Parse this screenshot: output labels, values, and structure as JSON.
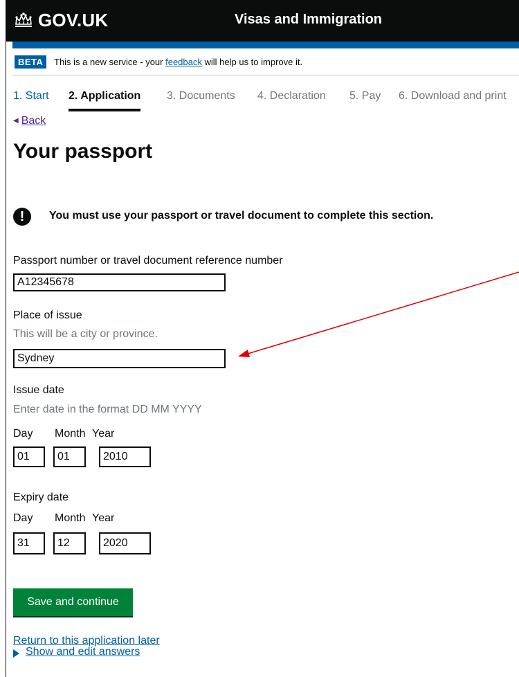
{
  "header": {
    "logo_text": "GOV.UK",
    "service_name": "Visas and Immigration"
  },
  "phase_banner": {
    "tag": "BETA",
    "text_before": "This is a new service - your ",
    "link_text": "feedback",
    "text_after": " will help us to improve it."
  },
  "steps": [
    {
      "label": "1. Start",
      "state": "done"
    },
    {
      "label": "2. Application",
      "state": "active"
    },
    {
      "label": "3. Documents",
      "state": "todo"
    },
    {
      "label": "4. Declaration",
      "state": "todo"
    },
    {
      "label": "5. Pay",
      "state": "todo"
    },
    {
      "label": "6. Download and print",
      "state": "todo"
    }
  ],
  "back_link": "Back",
  "page_title": "Your passport",
  "warning": {
    "icon": "exclamation-icon",
    "text": "You must use your passport or travel document to complete this section."
  },
  "form": {
    "passport_number": {
      "label": "Passport number or travel document reference number",
      "value": "A12345678"
    },
    "place_of_issue": {
      "label": "Place of issue",
      "hint": "This will be a city or province.",
      "value": "Sydney"
    },
    "issue_date": {
      "label": "Issue date",
      "hint": "Enter date in the format DD MM YYYY",
      "day_label": "Day",
      "month_label": "Month",
      "year_label": "Year",
      "day": "01",
      "month": "01",
      "year": "2010"
    },
    "expiry_date": {
      "label": "Expiry date",
      "day_label": "Day",
      "month_label": "Month",
      "year_label": "Year",
      "day": "31",
      "month": "12",
      "year": "2020"
    }
  },
  "save_button": "Save and continue",
  "return_link": "Return to this application later",
  "show_answers_link": "Show and edit answers",
  "colors": {
    "header_bg": "#0b0c0c",
    "brand_blue": "#005ea5",
    "button_green": "#00823b",
    "annotation_arrow": "#e00000"
  }
}
